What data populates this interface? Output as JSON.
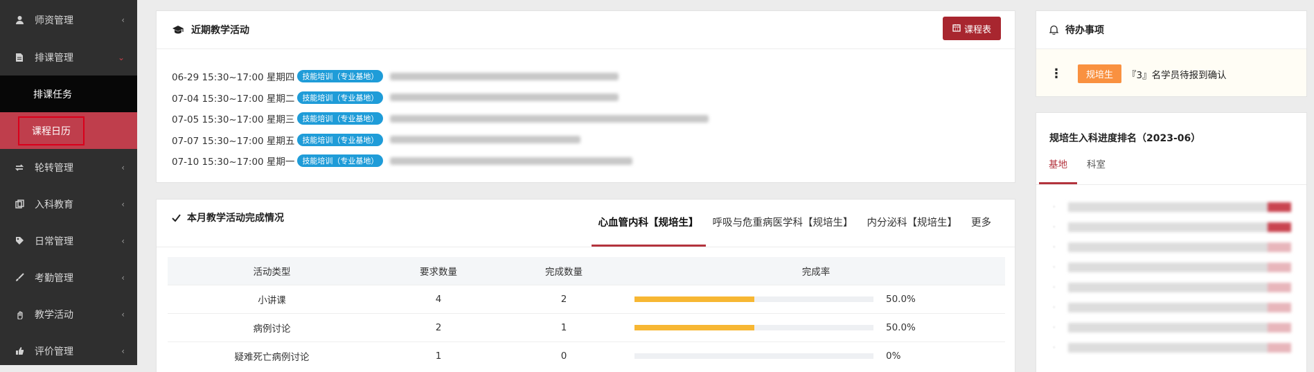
{
  "sidebar": {
    "items": [
      {
        "label": "师资管理",
        "icon": "teacher-icon"
      },
      {
        "label": "排课管理",
        "icon": "document-icon",
        "expanded": true
      },
      {
        "label": "轮转管理",
        "icon": "rotate-icon"
      },
      {
        "label": "入科教育",
        "icon": "copy-icon"
      },
      {
        "label": "日常管理",
        "icon": "tag-icon"
      },
      {
        "label": "考勤管理",
        "icon": "brush-icon"
      },
      {
        "label": "教学活动",
        "icon": "hand-icon"
      },
      {
        "label": "评价管理",
        "icon": "thumbs-up-icon"
      }
    ],
    "subitems": {
      "task": "排课任务",
      "calendar": "课程日历"
    }
  },
  "recent": {
    "title": "近期教学活动",
    "schedule_button": "课程表",
    "tag_label": "技能培训（专业基地）",
    "activities": [
      {
        "date": "06-29 15:30~17:00 星期四"
      },
      {
        "date": "07-04 15:30~17:00 星期二"
      },
      {
        "date": "07-05 15:30~17:00 星期三"
      },
      {
        "date": "07-07 15:30~17:00 星期五"
      },
      {
        "date": "07-10 15:30~17:00 星期一"
      }
    ]
  },
  "monthly": {
    "title": "本月教学活动完成情况",
    "tabs": [
      "心血管内科【规培生】",
      "呼吸与危重病医学科【规培生】",
      "内分泌科【规培生】",
      "更多"
    ],
    "active_tab": 0,
    "columns": [
      "活动类型",
      "要求数量",
      "完成数量",
      "完成率"
    ],
    "rows": [
      {
        "type": "小讲课",
        "required": "4",
        "done": "2",
        "rate_text": "50.0%",
        "rate": 0.5
      },
      {
        "type": "病例讨论",
        "required": "2",
        "done": "1",
        "rate_text": "50.0%",
        "rate": 0.5
      },
      {
        "type": "疑难死亡病例讨论",
        "required": "1",
        "done": "0",
        "rate_text": "0%",
        "rate": 0
      }
    ]
  },
  "todo": {
    "title": "待办事项",
    "badge": "规培生",
    "text": "『3』名学员待报到确认"
  },
  "ranking": {
    "title": "规培生入科进度排名（2023-06）",
    "tabs": [
      "基地",
      "科室"
    ],
    "active_tab": 0
  },
  "colors": {
    "accent": "#b3333d",
    "button": "#a8262f",
    "progress": "#f7b733",
    "tag": "#1f9cd8",
    "badge": "#f99140"
  }
}
